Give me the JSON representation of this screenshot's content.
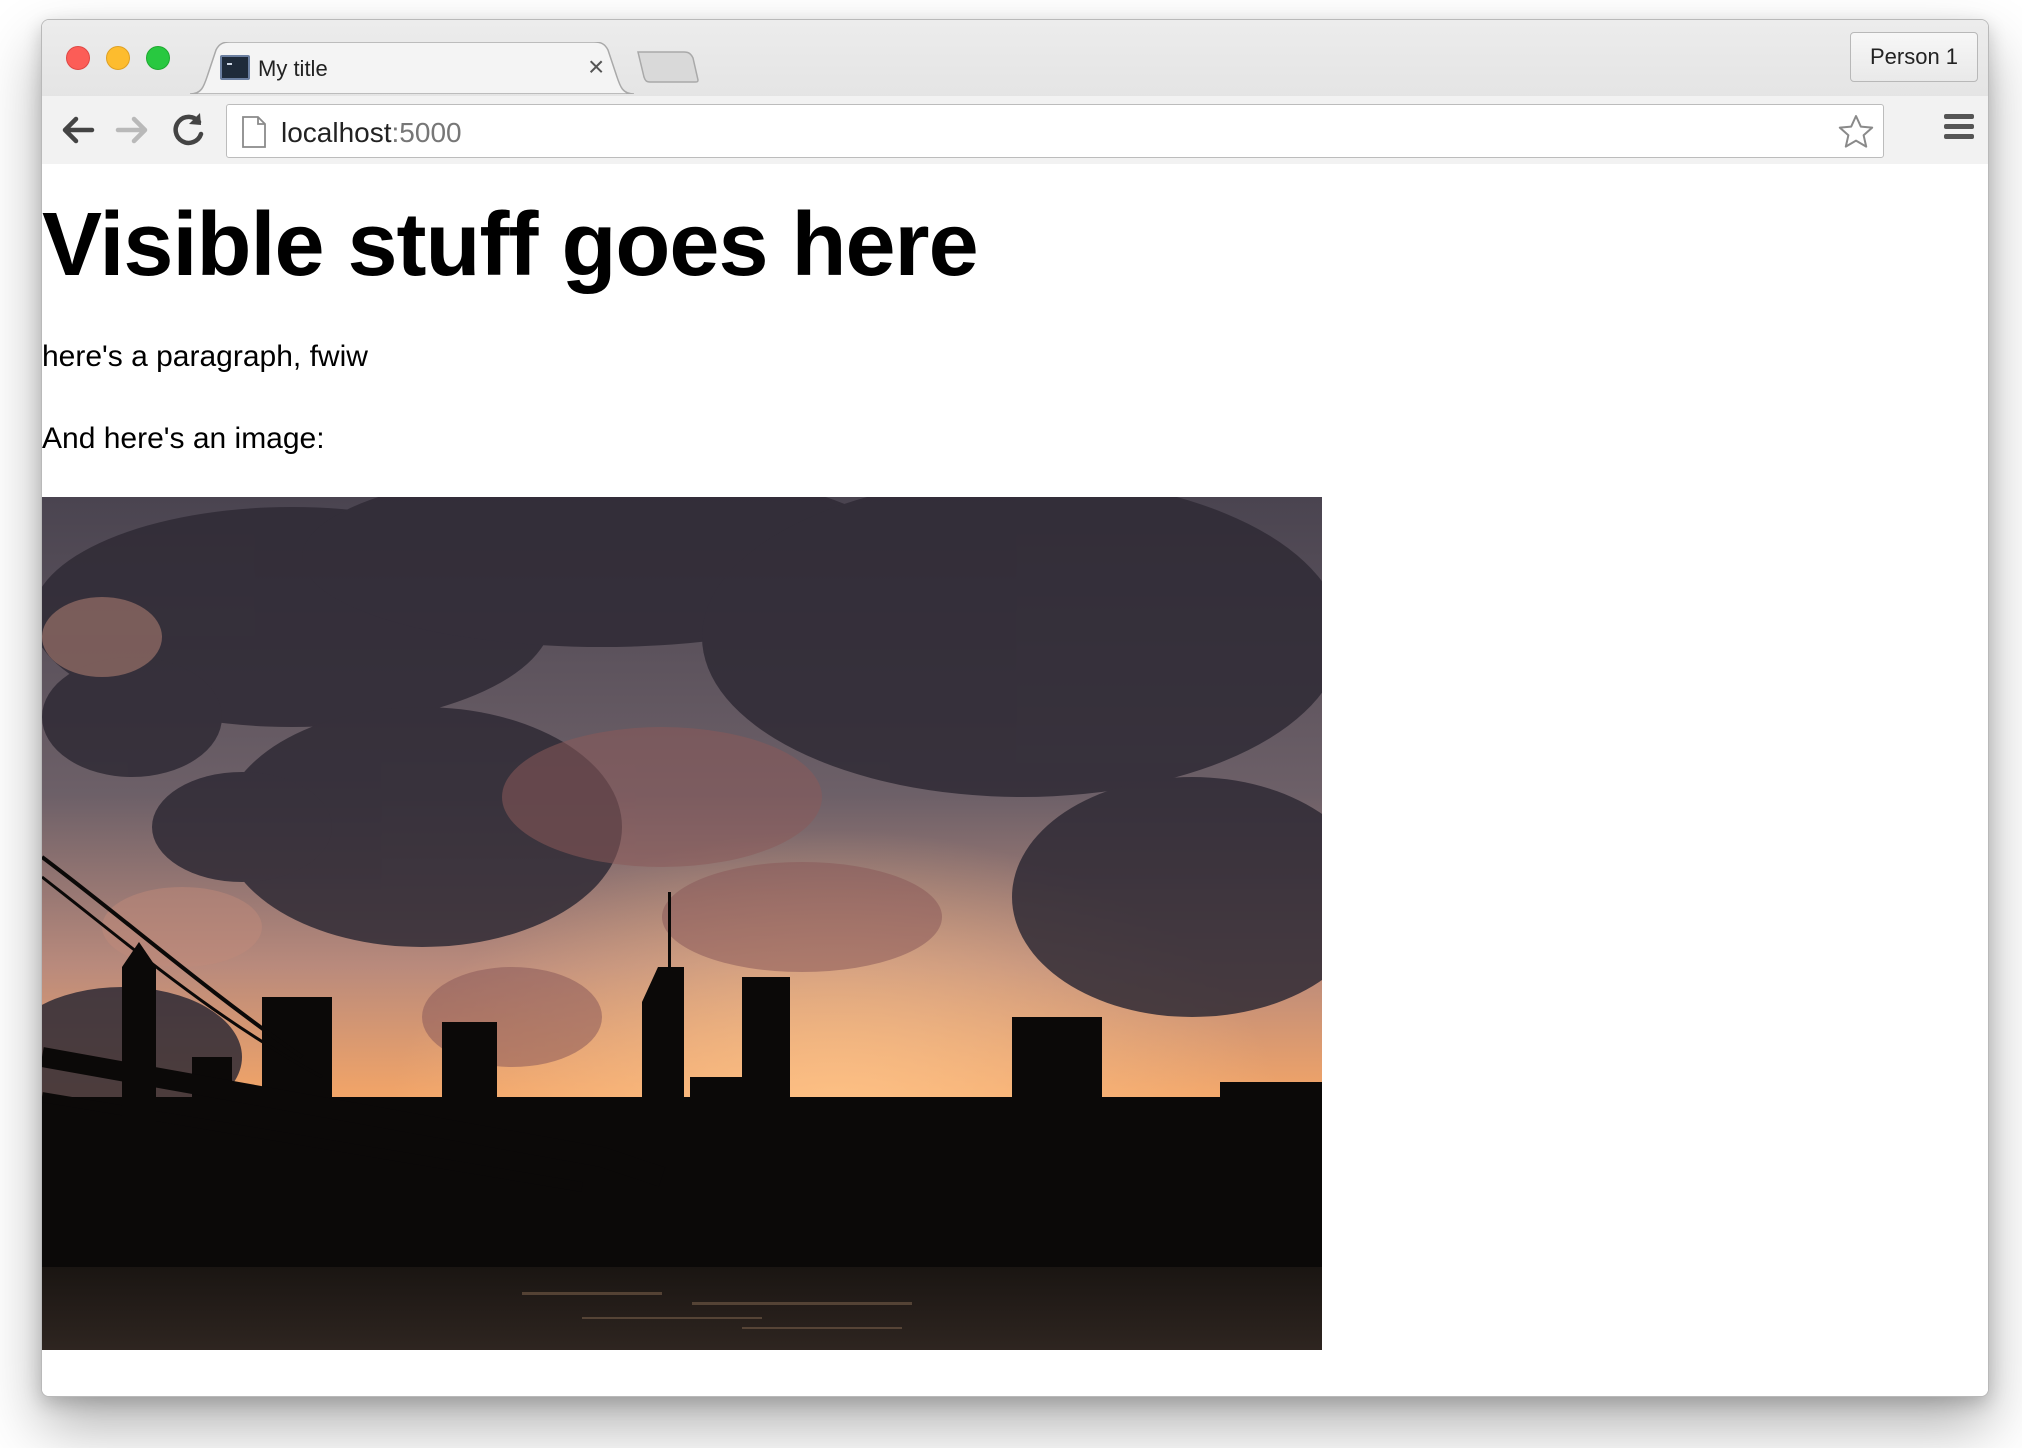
{
  "browser": {
    "tab": {
      "title": "My title"
    },
    "profile_label": "Person 1",
    "address": {
      "host": "localhost",
      "port": ":5000"
    }
  },
  "page": {
    "heading": "Visible stuff goes here",
    "paragraph_1": "here's a paragraph, fwiw",
    "paragraph_2": "And here's an image:",
    "image": {
      "description": "city skyline silhouette at sunset with bridge and dramatic clouds"
    }
  },
  "colors": {
    "close": "#fc5d57",
    "minimize": "#fdbc2e",
    "zoom": "#28c840",
    "sky_orange": "#f2a26b",
    "cloud_dark": "#3b3440"
  },
  "icons": [
    "back-arrow-icon",
    "forward-arrow-icon",
    "reload-icon",
    "page-icon",
    "star-icon",
    "hamburger-menu-icon",
    "terminal-favicon-icon",
    "close-icon"
  ]
}
